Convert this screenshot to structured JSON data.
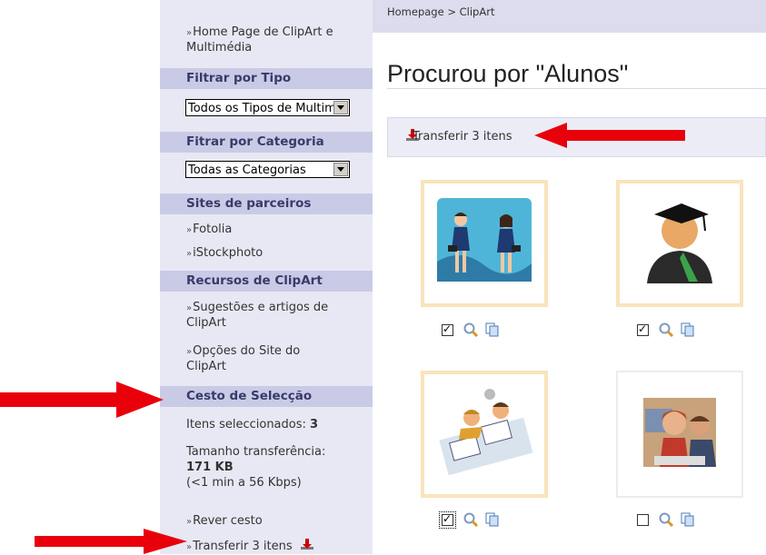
{
  "sidebar": {
    "home_link": "Home Page de ClipArt e Multimédia",
    "filter_type_header": "Filtrar por Tipo",
    "filter_type_value": "Todos os Tipos de Multimédia",
    "filter_category_header": "Fitrar por Categoria",
    "filter_category_value": "Todas as Categorias",
    "partners_header": "Sites de parceiros",
    "partners": [
      "Fotolia",
      "iStockphoto"
    ],
    "resources_header": "Recursos de ClipArt",
    "resources": [
      "Sugestões e artigos de ClipArt",
      "Opções do Site do ClipArt"
    ],
    "basket_header": "Cesto de Selecção",
    "selected_label": "Itens seleccionados:",
    "selected_count": "3",
    "size_label": "Tamanho transferência:",
    "size_value": "171 KB",
    "size_time": "(<1 min a 56 Kbps)",
    "review_link": "Rever cesto",
    "transfer_link": "Transferir 3 itens"
  },
  "breadcrumb": "Homepage  >  ClipArt",
  "page_title": "Procurou por \"Alunos\"",
  "transfer_button": "Transferir 3 itens",
  "results": [
    {
      "name": "students-clipart",
      "checked": true
    },
    {
      "name": "graduate-clipart",
      "checked": true
    },
    {
      "name": "studying-clipart",
      "checked": true
    },
    {
      "name": "students-photo",
      "checked": false
    }
  ],
  "colors": {
    "sidebar_bg": "#e8e8f4",
    "header_bg": "#c9cbe6",
    "arrow_red": "#e8000b",
    "selected_frame": "#f9e4bb"
  },
  "icons": [
    "download-icon",
    "magnifier-icon",
    "copy-icon",
    "checkbox-icon"
  ]
}
